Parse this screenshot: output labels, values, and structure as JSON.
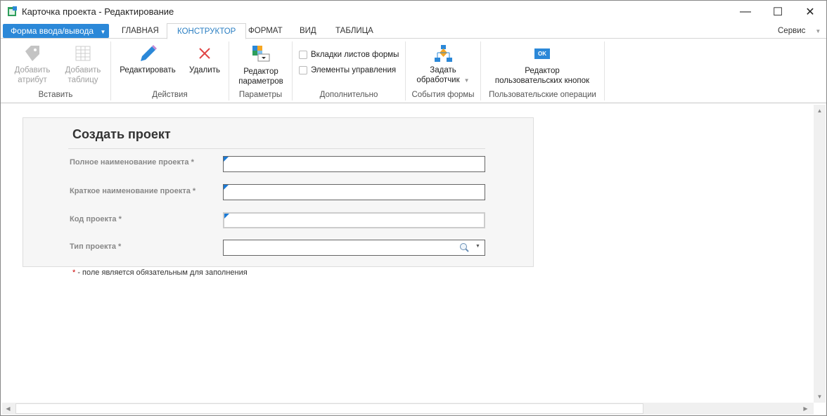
{
  "window": {
    "title": "Карточка проекта - Редактирование"
  },
  "tabs": {
    "file": "Форма ввода/вывода",
    "items": [
      "ГЛАВНАЯ",
      "КОНСТРУКТОР",
      "ФОРМАТ",
      "ВИД",
      "ТАБЛИЦА"
    ],
    "service": "Сервис"
  },
  "ribbon": {
    "insert": {
      "label": "Вставить",
      "add_attr": [
        "Добавить",
        "атрибут"
      ],
      "add_table": [
        "Добавить",
        "таблицу"
      ]
    },
    "actions": {
      "label": "Действия",
      "edit": "Редактировать",
      "delete": "Удалить"
    },
    "params": {
      "label": "Параметры",
      "editor": [
        "Редактор",
        "параметров"
      ]
    },
    "extra": {
      "label": "Дополнительно",
      "sheet_tabs": "Вкладки листов формы",
      "controls": "Элементы управления"
    },
    "events": {
      "label": "События формы",
      "handler": [
        "Задать",
        "обработчик"
      ]
    },
    "custom": {
      "label": "Пользовательские операции",
      "editor": [
        "Редактор",
        "пользовательских кнопок"
      ],
      "ok_icon": "OK"
    }
  },
  "form": {
    "title": "Создать проект",
    "fields": [
      "Полное наименование проекта *",
      "Краткое наименование проекта *",
      "Код проекта *",
      "Тип проекта *"
    ],
    "note_star": "*",
    "note": " - поле является обязательным для заполнения"
  }
}
